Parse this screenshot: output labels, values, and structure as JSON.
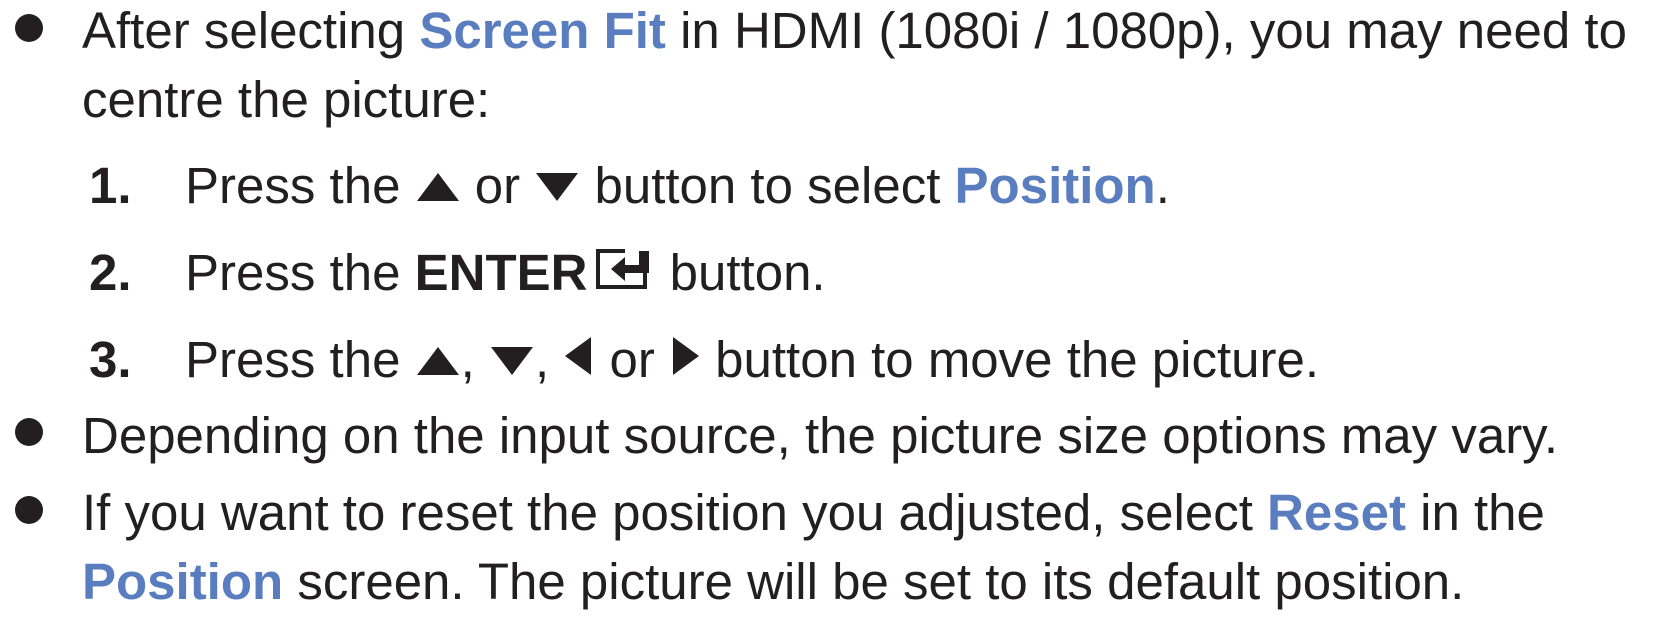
{
  "bullet1": {
    "before": "After selecting ",
    "highlight": "Screen Fit",
    "after": " in HDMI (1080i / 1080p), you may need to",
    "line2": "centre the picture:"
  },
  "steps": [
    {
      "number": "1.",
      "text_a": "Press the ",
      "text_b": " or ",
      "text_c": " button to select ",
      "highlight": "Position",
      "text_d": "."
    },
    {
      "number": "2.",
      "text_a": "Press the ",
      "bold": "ENTER",
      "text_b": " button."
    },
    {
      "number": "3.",
      "text_a": "Press the ",
      "text_b": ", ",
      "text_c": ", ",
      "text_d": " or ",
      "text_e": " button to move the picture."
    }
  ],
  "bullet2": {
    "text": "Depending on the input source, the picture size options may vary."
  },
  "bullet3": {
    "before": "If you want to reset the position you adjusted, select ",
    "highlight1": "Reset",
    "after": " in the",
    "highlight2": "Position",
    "line2_after": " screen. The picture will be set to its default position."
  },
  "icons": [
    "up-arrow-icon",
    "down-arrow-icon",
    "enter-icon",
    "left-arrow-icon",
    "right-arrow-icon"
  ],
  "colors": {
    "text": "#231f20",
    "highlight": "#5a7dc0"
  }
}
